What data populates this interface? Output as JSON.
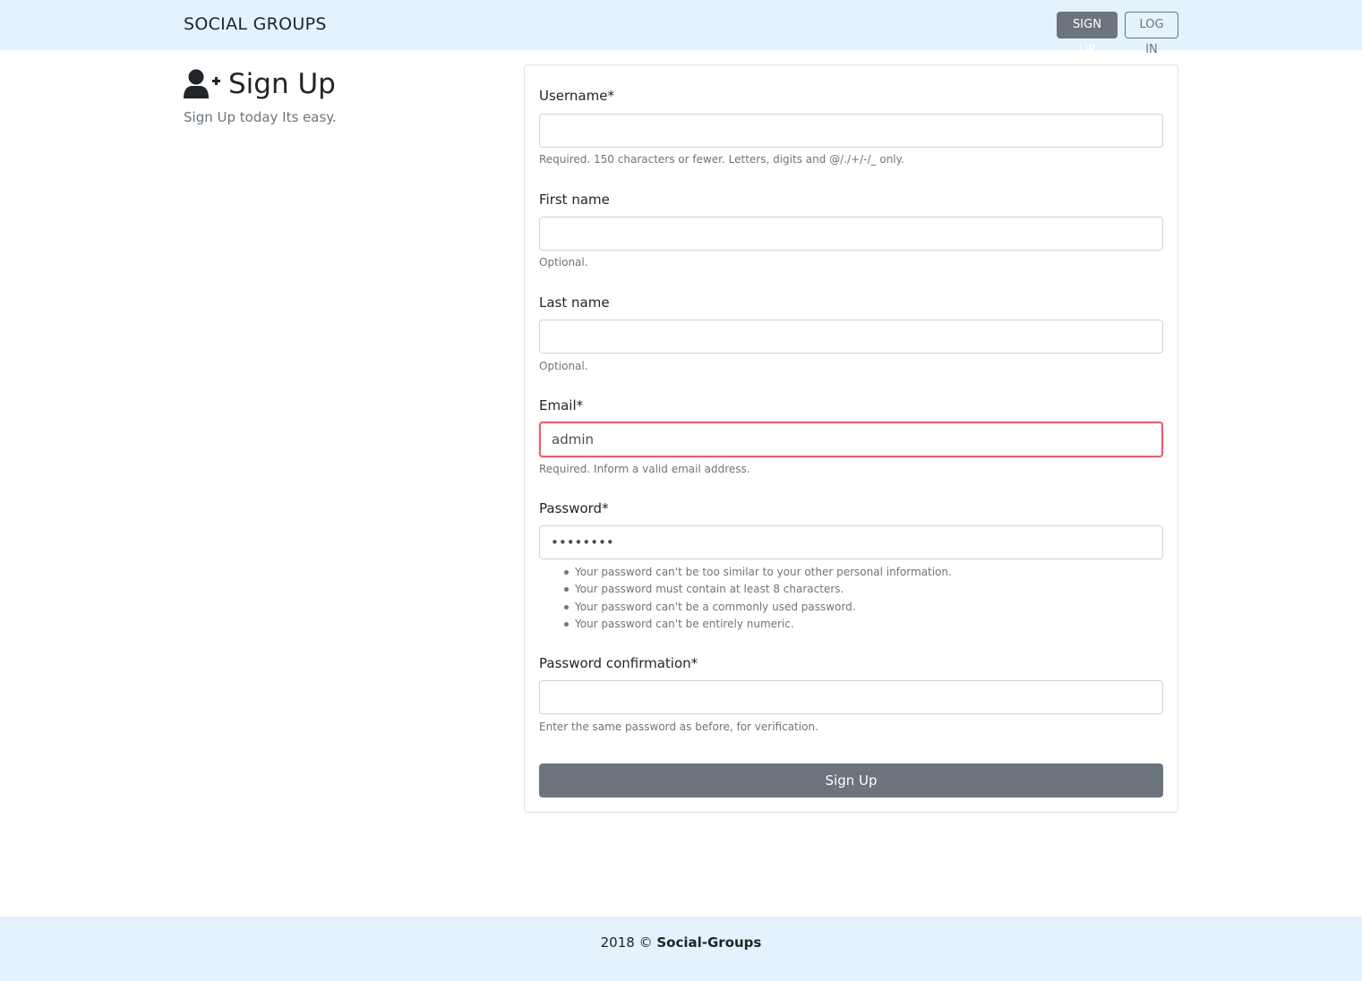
{
  "navbar": {
    "brand": "SOCIAL GROUPS",
    "signup_label": "SIGN UP",
    "login_label": "LOG IN",
    "background": "#e3f2fd"
  },
  "header": {
    "icon": "user-plus-icon",
    "title": "Sign Up",
    "subtitle": "Sign Up today Its easy."
  },
  "form": {
    "username": {
      "label": "Username*",
      "value": "",
      "help": "Required. 150 characters or fewer. Letters, digits and @/./+/-/_ only."
    },
    "first_name": {
      "label": "First name",
      "value": "",
      "help": "Optional."
    },
    "last_name": {
      "label": "Last name",
      "value": "",
      "help": "Optional."
    },
    "email": {
      "label": "Email*",
      "value": "admin",
      "help": "Required. Inform a valid email address.",
      "state": "invalid",
      "border_color": "#e4606d"
    },
    "password": {
      "label": "Password*",
      "value": "••••••••",
      "rules": [
        "Your password can't be too similar to your other personal information.",
        "Your password must contain at least 8 characters.",
        "Your password can't be a commonly used password.",
        "Your password can't be entirely numeric."
      ]
    },
    "password_confirmation": {
      "label": "Password confirmation*",
      "value": "",
      "help": "Enter the same password as before, for verification."
    },
    "submit_label": "Sign Up",
    "submit_color": "#6c757d"
  },
  "footer": {
    "year_copy": "2018 ©",
    "site": "Social-Groups"
  }
}
